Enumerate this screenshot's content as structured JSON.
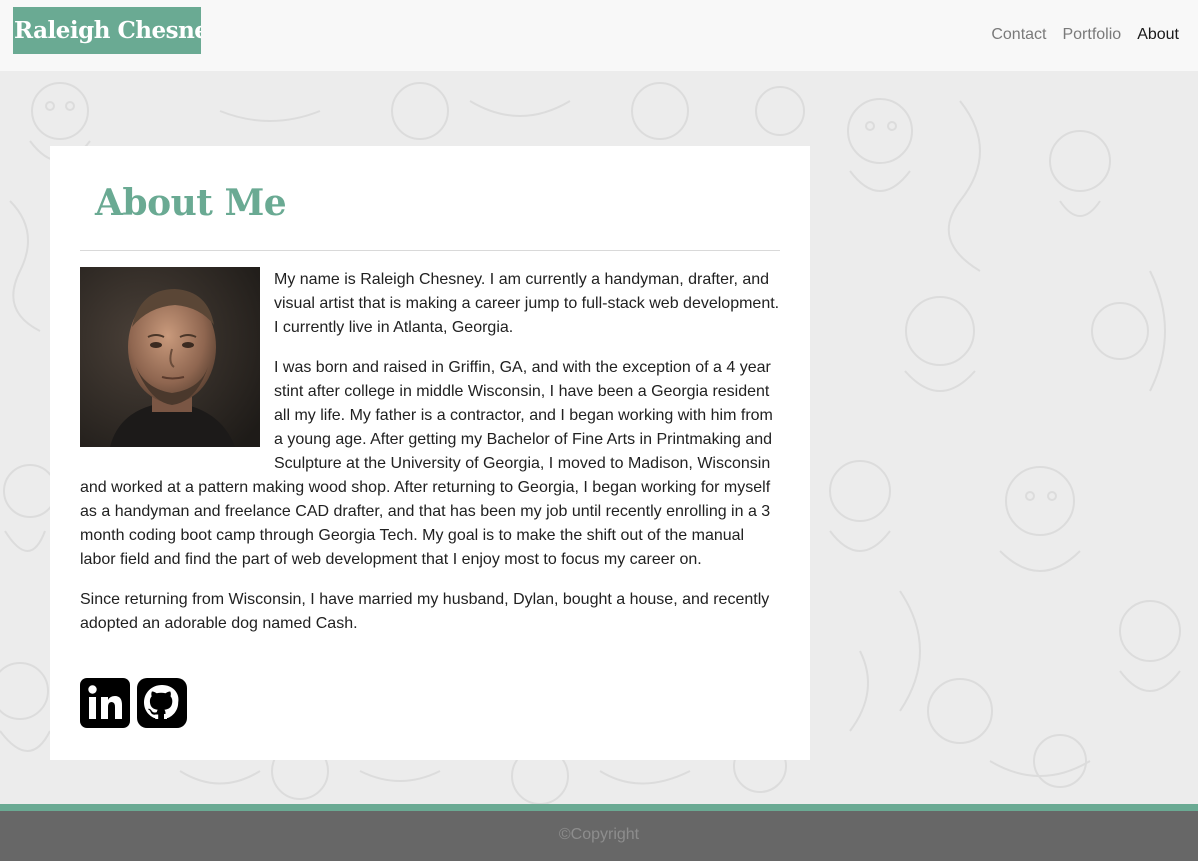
{
  "navbar": {
    "brand": "Raleigh Chesney",
    "links": [
      {
        "label": "Contact"
      },
      {
        "label": "Portfolio"
      },
      {
        "label": "About"
      }
    ]
  },
  "about": {
    "title": "About Me",
    "paragraphs": [
      "My name is Raleigh Chesney. I am currently a handyman, drafter, and visual artist that is making a career jump to full-stack web development. I currently live in Atlanta, Georgia.",
      "I was born and raised in Griffin, GA, and with the exception of a 4 year stint after college in middle Wisconsin, I have been a Georgia resident all my life. My father is a contractor, and I began working with him from a young age. After getting my Bachelor of Fine Arts in Printmaking and Sculpture at the University of Georgia, I moved to Madison, Wisconsin and worked at a pattern making wood shop. After returning to Georgia, I began working for myself as a handyman and freelance CAD drafter, and that has been my job until recently enrolling in a 3 month coding boot camp through Georgia Tech. My goal is to make the shift out of the manual labor field and find the part of web development that I enjoy most to focus my career on.",
      "Since returning from Wisconsin, I have married my husband, Dylan, bought a house, and recently adopted an adorable dog named Cash."
    ],
    "social": [
      {
        "icon": "linkedin-icon"
      },
      {
        "icon": "github-icon"
      }
    ]
  },
  "footer": {
    "copyright": "©Copyright"
  },
  "colors": {
    "accent": "#6aaa93",
    "footer": "#676767",
    "navbar": "#f8f8f8"
  }
}
